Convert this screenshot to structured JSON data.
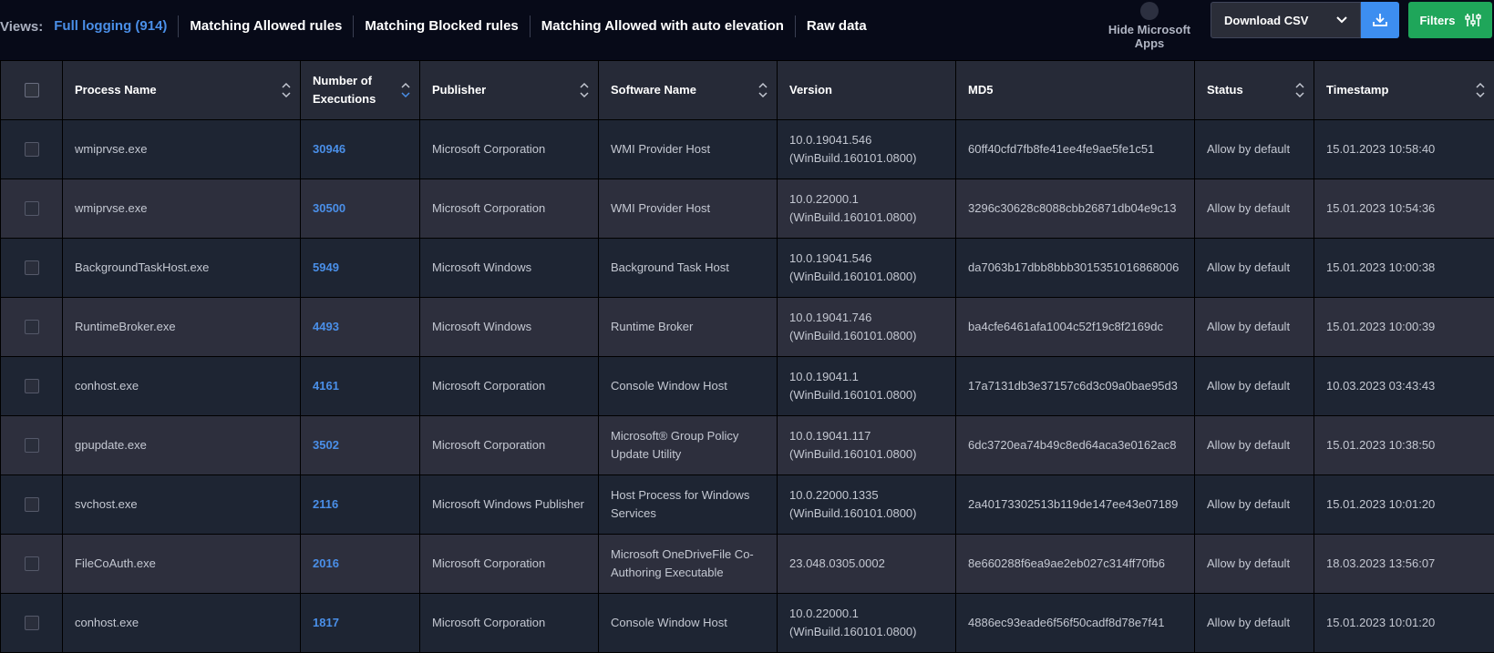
{
  "views": {
    "label": "Views:",
    "items": [
      {
        "label": "Full logging (914)",
        "active": true
      },
      {
        "label": "Matching Allowed rules",
        "active": false
      },
      {
        "label": "Matching Blocked rules",
        "active": false
      },
      {
        "label": "Matching Allowed with auto elevation",
        "active": false
      },
      {
        "label": "Raw data",
        "active": false
      }
    ]
  },
  "toolbar": {
    "hide_ms_label": "Hide Microsoft Apps",
    "download_label": "Download CSV",
    "filters_label": "Filters"
  },
  "colors": {
    "accent": "#4a8fe8",
    "download_icon_bg": "#3d8ef0",
    "filters_bg": "#1fa65a"
  },
  "table": {
    "columns": [
      "",
      "Process Name",
      "Number of Executions",
      "Publisher",
      "Software Name",
      "Version",
      "MD5",
      "Status",
      "Timestamp"
    ],
    "sort_active": "Number of Executions",
    "rows": [
      {
        "process": "wmiprvse.exe",
        "executions": "30946",
        "publisher": "Microsoft Corporation",
        "software": "WMI Provider Host",
        "version": "10.0.19041.546 (WinBuild.160101.0800)",
        "md5": "60ff40cfd7fb8fe41ee4fe9ae5fe1c51",
        "status": "Allow by default",
        "timestamp": "15.01.2023 10:58:40"
      },
      {
        "process": "wmiprvse.exe",
        "executions": "30500",
        "publisher": "Microsoft Corporation",
        "software": "WMI Provider Host",
        "version": "10.0.22000.1 (WinBuild.160101.0800)",
        "md5": "3296c30628c8088cbb26871db04e9c13",
        "status": "Allow by default",
        "timestamp": "15.01.2023 10:54:36"
      },
      {
        "process": "BackgroundTaskHost.exe",
        "executions": "5949",
        "publisher": "Microsoft Windows",
        "software": "Background Task Host",
        "version": "10.0.19041.546 (WinBuild.160101.0800)",
        "md5": "da7063b17dbb8bbb3015351016868006",
        "status": "Allow by default",
        "timestamp": "15.01.2023 10:00:38"
      },
      {
        "process": "RuntimeBroker.exe",
        "executions": "4493",
        "publisher": "Microsoft Windows",
        "software": "Runtime Broker",
        "version": "10.0.19041.746 (WinBuild.160101.0800)",
        "md5": "ba4cfe6461afa1004c52f19c8f2169dc",
        "status": "Allow by default",
        "timestamp": "15.01.2023 10:00:39"
      },
      {
        "process": "conhost.exe",
        "executions": "4161",
        "publisher": "Microsoft Corporation",
        "software": "Console Window Host",
        "version": "10.0.19041.1 (WinBuild.160101.0800)",
        "md5": "17a7131db3e37157c6d3c09a0bae95d3",
        "status": "Allow by default",
        "timestamp": "10.03.2023 03:43:43"
      },
      {
        "process": "gpupdate.exe",
        "executions": "3502",
        "publisher": "Microsoft Corporation",
        "software": "Microsoft® Group Policy Update Utility",
        "version": "10.0.19041.117 (WinBuild.160101.0800)",
        "md5": "6dc3720ea74b49c8ed64aca3e0162ac8",
        "status": "Allow by default",
        "timestamp": "15.01.2023 10:38:50"
      },
      {
        "process": "svchost.exe",
        "executions": "2116",
        "publisher": "Microsoft Windows Publisher",
        "software": "Host Process for Windows Services",
        "version": "10.0.22000.1335 (WinBuild.160101.0800)",
        "md5": "2a40173302513b119de147ee43e07189",
        "status": "Allow by default",
        "timestamp": "15.01.2023 10:01:20"
      },
      {
        "process": "FileCoAuth.exe",
        "executions": "2016",
        "publisher": "Microsoft Corporation",
        "software": "Microsoft OneDriveFile Co-Authoring Executable",
        "version": "23.048.0305.0002",
        "md5": "8e660288f6ea9ae2eb027c314ff70fb6",
        "status": "Allow by default",
        "timestamp": "18.03.2023 13:56:07"
      },
      {
        "process": "conhost.exe",
        "executions": "1817",
        "publisher": "Microsoft Corporation",
        "software": "Console Window Host",
        "version": "10.0.22000.1 (WinBuild.160101.0800)",
        "md5": "4886ec93eade6f56f50cadf8d78e7f41",
        "status": "Allow by default",
        "timestamp": "15.01.2023 10:01:20"
      }
    ]
  }
}
